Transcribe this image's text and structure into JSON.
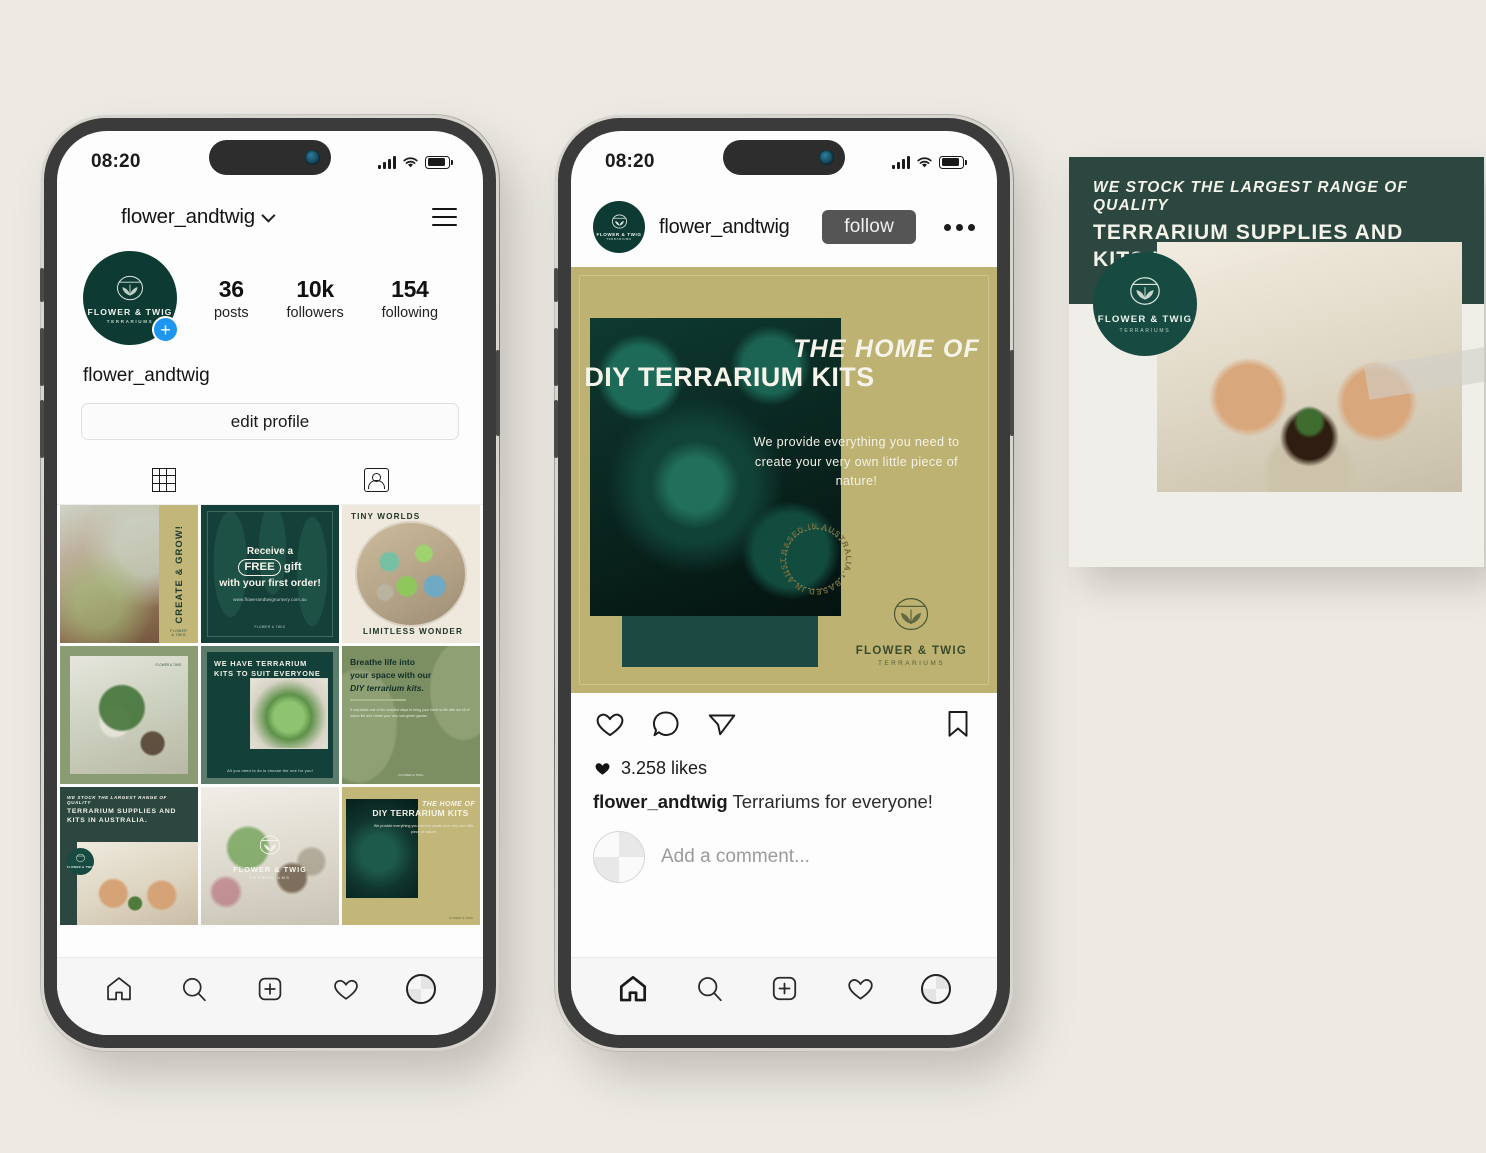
{
  "background_color": "#edeae4",
  "brand": {
    "name": "FLOWER & TWIG",
    "tagline": "TERRARIUMS",
    "green": "#0d3b33",
    "dark_green": "#2b4740",
    "olive": "#bdb271"
  },
  "phone1": {
    "status": {
      "time": "08:20",
      "signal_icon": "cellular-signal-icon",
      "wifi_icon": "wifi-icon",
      "battery_icon": "battery-icon"
    },
    "header": {
      "username": "flower_andtwig",
      "chevron_icon": "chevron-down-icon",
      "menu_icon": "hamburger-menu-icon"
    },
    "avatar": {
      "logo_title": "FLOWER & TWIG",
      "logo_sub": "TERRARIUMS",
      "add_story_icon": "plus-icon",
      "add_story_label": "+"
    },
    "stats": [
      {
        "value": "36",
        "label": "posts"
      },
      {
        "value": "10k",
        "label": "followers"
      },
      {
        "value": "154",
        "label": "following"
      }
    ],
    "bio_name": "flower_andtwig",
    "edit_profile_label": "edit profile",
    "tabs": [
      {
        "name": "grid-tab",
        "icon": "grid-icon"
      },
      {
        "name": "tagged-tab",
        "icon": "tagged-person-icon"
      }
    ],
    "grid": [
      {
        "id": "tile-terrarium-photo",
        "strip_text": "CREATE & GROW!",
        "logo": "FLOWER & TWIG"
      },
      {
        "id": "tile-free-gift",
        "line1": "Receive a",
        "pill": "FREE",
        "line2_rest": "gift",
        "line3": "with your first order!",
        "url": "www.flowerandtwignursery.com.au",
        "logo": "FLOWER & TWIG"
      },
      {
        "id": "tile-tiny-worlds",
        "top_caption": "TINY WORLDS",
        "bottom_caption": "LIMITLESS WONDER"
      },
      {
        "id": "tile-big-bowl",
        "logo": "FLOWER & TWIG"
      },
      {
        "id": "tile-kits-suit-everyone",
        "heading": "WE HAVE TERRARIUM KITS TO SUIT EVERYONE",
        "subtext": "All you need to do is choose the one for you!"
      },
      {
        "id": "tile-breathe-life",
        "line1": "Breathe life into",
        "line2": "your space with our",
        "line3": "DIY terrarium kits.",
        "paragraph": "It only takes one of the simplest steps to bring your home to life with our kit of indoor life and create your very own green garden.",
        "logo": "FLOWER & TWIG"
      },
      {
        "id": "tile-we-stock",
        "italic_line": "WE STOCK THE LARGEST RANGE OF QUALITY",
        "bold_line": "TERRARIUM SUPPLIES AND KITS IN AUSTRALIA.",
        "badge_logo": "FLOWER & TWIG"
      },
      {
        "id": "tile-shelf-brand",
        "logo_title": "FLOWER & TWIG",
        "logo_sub": "TERRARIUMS"
      },
      {
        "id": "tile-diy-kits",
        "line1": "THE HOME OF",
        "line2": "DIY TERRARIUM KITS",
        "sub": "We provide everything you need to create your very own little piece of nature!",
        "logo": "FLOWER & TWIG"
      }
    ],
    "bottom_nav": [
      {
        "name": "home-tab",
        "icon": "home-icon"
      },
      {
        "name": "search-tab",
        "icon": "search-icon"
      },
      {
        "name": "create-tab",
        "icon": "plus-square-icon"
      },
      {
        "name": "activity-tab",
        "icon": "heart-icon"
      },
      {
        "name": "profile-tab",
        "icon": "avatar-icon"
      }
    ]
  },
  "phone2": {
    "status": {
      "time": "08:20",
      "signal_icon": "cellular-signal-icon",
      "wifi_icon": "wifi-icon",
      "battery_icon": "battery-icon"
    },
    "post_header": {
      "username": "flower_andtwig",
      "follow_label": "follow",
      "more_icon": "more-options-icon"
    },
    "post_image": {
      "heading_italic": "THE HOME OF",
      "heading_bold": "DIY TERRARIUM KITS",
      "subtext": "We provide everything you need to create your very own little piece of nature!",
      "stamp_text": "BASED IN AUSTRALIA",
      "logo_title": "FLOWER & TWIG",
      "logo_sub": "TERRARIUMS"
    },
    "actions": [
      {
        "name": "like-button",
        "icon": "heart-icon"
      },
      {
        "name": "comment-button",
        "icon": "comment-bubble-icon"
      },
      {
        "name": "share-button",
        "icon": "paper-plane-icon"
      },
      {
        "name": "save-button",
        "icon": "bookmark-icon"
      }
    ],
    "likes_text": "3.258 likes",
    "likes_icon": "heart-filled-icon",
    "caption_user": "flower_andtwig",
    "caption_text": "Terrariums for everyone!",
    "comment_placeholder": "Add a comment...",
    "bottom_nav": [
      {
        "name": "home-tab",
        "icon": "home-icon"
      },
      {
        "name": "search-tab",
        "icon": "search-icon"
      },
      {
        "name": "create-tab",
        "icon": "plus-square-icon"
      },
      {
        "name": "activity-tab",
        "icon": "heart-icon"
      },
      {
        "name": "profile-tab",
        "icon": "avatar-icon"
      }
    ]
  },
  "card3": {
    "italic_line": "WE STOCK THE LARGEST RANGE OF QUALITY",
    "bold_line": "TERRARIUM SUPPLIES AND KITS IN AUSTRALIA.",
    "logo_title": "FLOWER & TWIG",
    "logo_sub": "TERRARIUMS"
  }
}
